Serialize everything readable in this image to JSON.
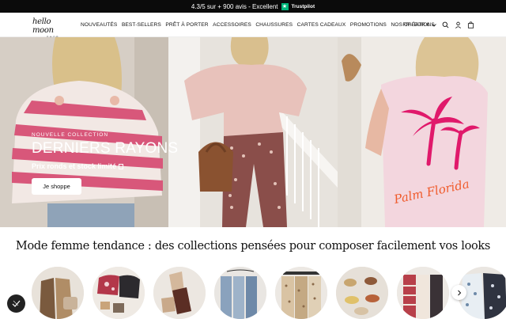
{
  "topbar": {
    "rating_text": "4.3/5 sur + 900 avis - Excellent",
    "trustpilot_label": "Trustpilot",
    "colors": {
      "background": "#0b0b0b",
      "trustpilot_green": "#00b67a"
    }
  },
  "header": {
    "logo_text": "hello moon",
    "logo_sub": "SHOP",
    "nav": [
      "NOUVEAUTÉS",
      "BEST-SELLERS",
      "PRÊT À PORTER",
      "ACCESSOIRES",
      "CHAUSSURES",
      "CARTES CADEAUX",
      "PROMOTIONS",
      "NOS CRÉATIONS"
    ],
    "locale": "FR - EUR €",
    "icons": [
      "search-icon",
      "account-icon",
      "cart-icon"
    ]
  },
  "hero": {
    "kicker": "NOUVELLE COLLECTION",
    "title": "DERNIERS RAYONS",
    "subtitle": "Prix ronds et stock limité",
    "cta": "Je shoppe",
    "print_text": "Palm Florida"
  },
  "section": {
    "title": "Mode femme tendance : des collections pensées pour composer facilement vos looks"
  },
  "categories": [
    "cat-manteaux",
    "cat-imprimes",
    "cat-chaussures",
    "cat-jeans",
    "cat-jupes",
    "cat-sandales",
    "cat-mailles",
    "cat-robes"
  ],
  "carousel": {
    "next_icon": "chevron-right-icon"
  }
}
